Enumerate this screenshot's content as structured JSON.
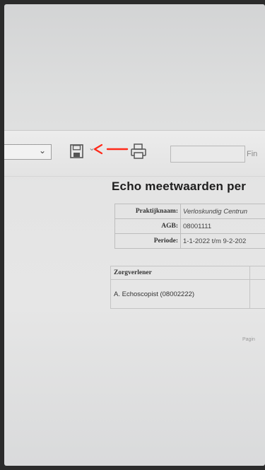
{
  "toolbar": {
    "select_chevron": "⌄",
    "save_icon": "save-icon",
    "save_dropdown_chevron": "⌄",
    "print_icon": "print-icon",
    "find_value": "",
    "find_label": "Fin",
    "annotation_arrow_color": "#ff2a1a"
  },
  "report": {
    "title": "Echo meetwaarden per",
    "info": [
      {
        "label": "Praktijknaam:",
        "value": "Verloskundig Centrun"
      },
      {
        "label": "AGB:",
        "value": "08001111"
      },
      {
        "label": "Periode:",
        "value": "1-1-2022 t/m 9-2-202"
      }
    ],
    "table": {
      "header": "Zorgverlener",
      "rows": [
        {
          "name": "A. Echoscopist (08002222)"
        }
      ]
    },
    "page_label": "Pagin"
  }
}
